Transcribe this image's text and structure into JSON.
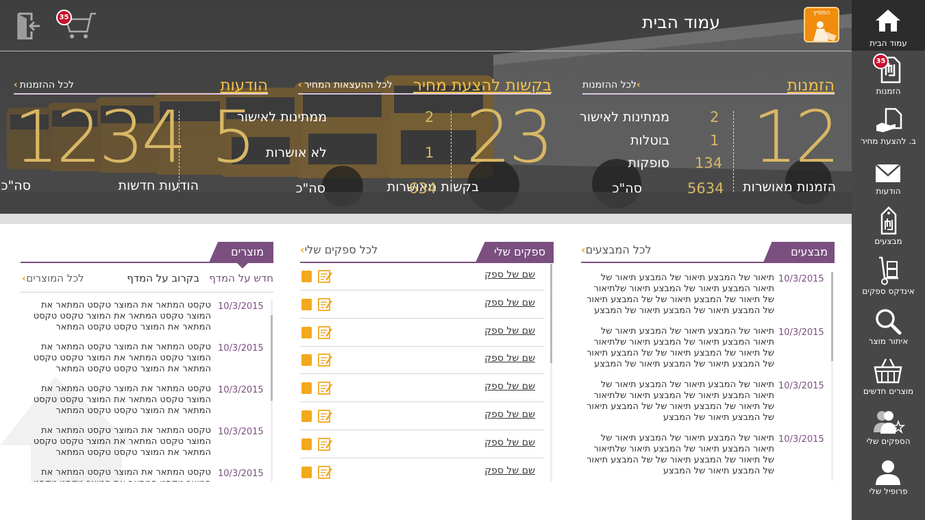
{
  "header": {
    "page_title": "עמוד הבית",
    "logo_text": "המפיץ",
    "cart_count": "35"
  },
  "orders": {
    "title": "הזמנות",
    "link": "לכל ההזמנות",
    "big_number": "12",
    "big_label": "הזמנות מאושרות",
    "rows": [
      {
        "value": "2",
        "label": "ממתינות לאישור"
      },
      {
        "value": "1",
        "label": "בוטלות"
      },
      {
        "value": "134",
        "label": "סופקות"
      },
      {
        "value": "5634",
        "label": "סה\"כ"
      }
    ]
  },
  "quotes": {
    "title": "בקשות להצעת מחיר",
    "link": "לכל ההעצאות המחיר",
    "big_number": "23",
    "big_label": "בקשות מאושרות",
    "rows": [
      {
        "value": "2",
        "label": "ממתינות לאישור"
      },
      {
        "value": "1",
        "label": "לא אושרות"
      },
      {
        "value": "634",
        "label": "סה\"כ"
      }
    ]
  },
  "messages": {
    "title": "הודעות",
    "link": "לכל ההזמנות",
    "new_number": "5",
    "new_label": "הודעות חדשות",
    "total_number": "1234",
    "total_label": "סה\"כ"
  },
  "sidebar": {
    "items": [
      {
        "label": "עמוד הבית",
        "icon": "home-icon"
      },
      {
        "label": "הזמנות",
        "icon": "shekel-document-icon",
        "badge": "35"
      },
      {
        "label": "ב. להצעת מחיר",
        "icon": "hand-document-icon"
      },
      {
        "label": "הודעות",
        "icon": "envelope-icon"
      },
      {
        "label": "מבצעים",
        "icon": "price-tag-icon"
      },
      {
        "label": "אינדקס ספקים",
        "icon": "hand-truck-icon"
      },
      {
        "label": "איתור מוצר",
        "icon": "search-icon"
      },
      {
        "label": "מוצרים חדשים",
        "icon": "basket-icon"
      },
      {
        "label": "הספקים שלי",
        "icon": "users-star-icon"
      },
      {
        "label": "פרופיל שלי",
        "icon": "user-icon"
      }
    ]
  },
  "promotions": {
    "tab": "מבצעים",
    "link": "לכל המבצעים",
    "items": [
      {
        "date": "10/3/2015",
        "text": "תיאור של המבצע תיאור של המבצע תיאור של תיאור המבצע תיאור של המבצע תיאור שלתיאור של תיאור של המבצע תיאור של של המבצע תיאור של המבצע תיאור של המבצע תיאור של המבצע"
      },
      {
        "date": "10/3/2015",
        "text": "תיאור של המבצע תיאור של המבצע תיאור של תיאור המבצע תיאור של המבצע תיאור שלתיאור של תיאור של המבצע תיאור של של המבצע תיאור של המבצע תיאור של המבצע תיאור של המבצע"
      },
      {
        "date": "10/3/2015",
        "text": "תיאור של המבצע תיאור של המבצע תיאור של תיאור המבצע תיאור של המבצע תיאור שלתיאור של תיאור של המבצע תיאור של של המבצע תיאור של המבצע תיאור של המבצע"
      },
      {
        "date": "10/3/2015",
        "text": "תיאור של המבצע תיאור של המבצע תיאור של תיאור המבצע תיאור של המבצע תיאור שלתיאור של תיאור של המבצע תיאור של של המבצע תיאור של המבצע תיאור של המבצע"
      }
    ]
  },
  "suppliers": {
    "tab": "ספקים שלי",
    "link": "לכל ספקים שלי",
    "items": [
      "שם של ספק",
      "שם של ספק",
      "שם של ספק",
      "שם של ספק",
      "שם של ספק",
      "שם של ספק",
      "שם של ספק",
      "שם של ספק"
    ]
  },
  "products": {
    "tab": "מוצרים",
    "link": "לכל המוצרים",
    "tab_new": "חדש על המדף",
    "tab_soon": "בקרוב על המדף",
    "items": [
      {
        "date": "10/3/2015",
        "text": "טקסט המתאר את המוצר טקסט המתאר את המוצר טקסט המתאר את המוצר טקסט טקסט המתאר את המוצר טקסט טקסט המתאר"
      },
      {
        "date": "10/3/2015",
        "text": "טקסט המתאר את המוצר טקסט המתאר את המוצר טקסט המתאר את המוצר טקסט טקסט המתאר את המוצר טקסט טקסט המתאר"
      },
      {
        "date": "10/3/2015",
        "text": "טקסט המתאר את המוצר טקסט המתאר את המוצר טקסט המתאר את המוצר טקסט טקסט המתאר את המוצר טקסט טקסט המתאר"
      },
      {
        "date": "10/3/2015",
        "text": "טקסט המתאר את המוצר טקסט המתאר את המוצר טקסט המתאר את המוצר טקסט טקסט המתאר את המוצר טקסט טקסט המתאר"
      },
      {
        "date": "10/3/2015",
        "text": "טקסט המתאר את המוצר טקסט המתאר את המוצר טקסט המתאר את המוצר טקסט טקסט המתאר את המוצר טקסט טקסט המתאר"
      }
    ]
  },
  "colors": {
    "accent_purple": "#7b4f80",
    "accent_orange": "#f2a81d",
    "gold_numbers": "#d8b765",
    "sidebar_bg": "#474747",
    "badge_red": "#c8102e"
  }
}
